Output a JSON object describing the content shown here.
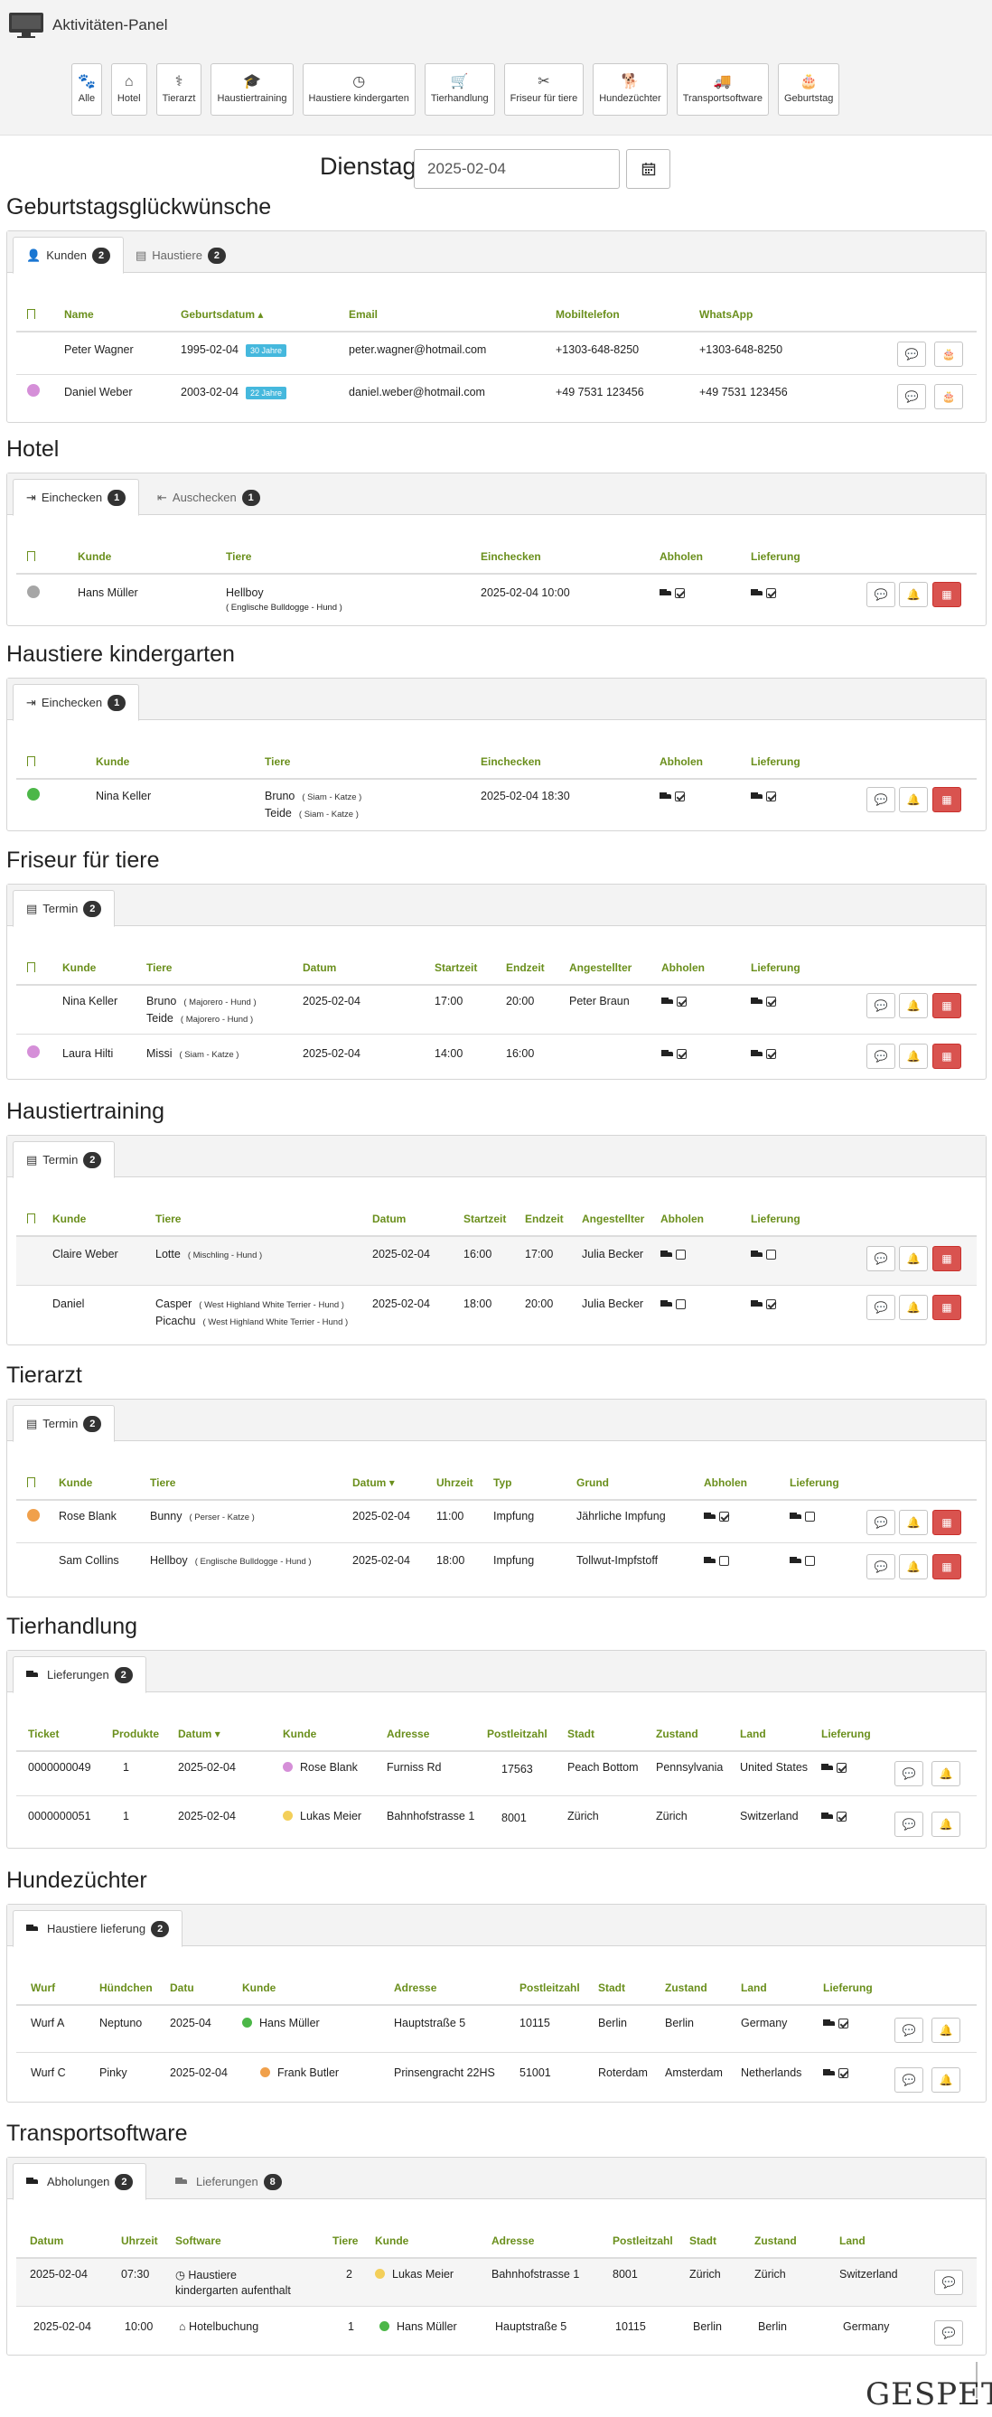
{
  "app": {
    "title": "Aktivitäten-Panel"
  },
  "categories": [
    {
      "label": "Alle",
      "icon": "paw-icon",
      "glyph": "🐾"
    },
    {
      "label": "Hotel",
      "icon": "home-icon",
      "glyph": "⌂"
    },
    {
      "label": "Tierarzt",
      "icon": "user-md-icon",
      "glyph": "⚕"
    },
    {
      "label": "Haustiertraining",
      "icon": "graduation-cap-icon",
      "glyph": "🎓"
    },
    {
      "label": "Haustiere kindergarten",
      "icon": "clock-icon",
      "glyph": "◷"
    },
    {
      "label": "Tierhandlung",
      "icon": "cart-icon",
      "glyph": "🛒"
    },
    {
      "label": "Friseur für tiere",
      "icon": "scissors-icon",
      "glyph": "✂"
    },
    {
      "label": "Hundezüchter",
      "icon": "dog-icon",
      "glyph": "🐕"
    },
    {
      "label": "Transportsoftware",
      "icon": "truck-icon",
      "glyph": "🚚"
    },
    {
      "label": "Geburtstag",
      "icon": "birthday-cake-icon",
      "glyph": "🎂"
    }
  ],
  "date": {
    "label": "Dienstag,",
    "value": "2025-02-04"
  },
  "birthday": {
    "title": "Geburtstagsglückwünsche",
    "tabs": [
      {
        "label": "Kunden",
        "count": "2"
      },
      {
        "label": "Haustiere",
        "count": "2"
      }
    ],
    "headers": [
      "Name",
      "Geburtsdatum",
      "Email",
      "Mobiltelefon",
      "WhatsApp"
    ],
    "rows": [
      {
        "name": "Peter Wagner",
        "birth": "1995-02-04",
        "age": "30 Jahre",
        "email": "peter.wagner@hotmail.com",
        "mobile": "+1303-648-8250",
        "whatsapp": "+1303-648-8250",
        "dot": ""
      },
      {
        "name": "Daniel Weber",
        "birth": "2003-02-04",
        "age": "22 Jahre",
        "email": "daniel.weber@hotmail.com",
        "mobile": "+49 7531 123456",
        "whatsapp": "+49 7531 123456",
        "dot": "#d58fd8"
      }
    ]
  },
  "hotel": {
    "title": "Hotel",
    "tabs": [
      {
        "label": "Einchecken",
        "count": "1"
      },
      {
        "label": "Auschecken",
        "count": "1"
      }
    ],
    "headers": [
      "Kunde",
      "Tiere",
      "Einchecken",
      "Abholen",
      "Lieferung"
    ],
    "rows": [
      {
        "customer": "Hans Müller",
        "pet": "Hellboy",
        "pet_sub": "( Englische Bulldogge - Hund )",
        "checkin": "2025-02-04 10:00",
        "dot": "#a6a6a6",
        "pickup": true,
        "delivery": true
      }
    ]
  },
  "kindergarten": {
    "title": "Haustiere kindergarten",
    "tabs": [
      {
        "label": "Einchecken",
        "count": "1"
      }
    ],
    "headers": [
      "Kunde",
      "Tiere",
      "Einchecken",
      "Abholen",
      "Lieferung"
    ],
    "rows": [
      {
        "customer": "Nina Keller",
        "pet1": "Bruno",
        "pet1_sub": "( Siam - Katze )",
        "pet2": "Teide",
        "pet2_sub": "( Siam - Katze )",
        "checkin": "2025-02-04 18:30",
        "dot": "#4cb748",
        "pickup": true,
        "delivery": true
      }
    ]
  },
  "groomer": {
    "title": "Friseur für tiere",
    "tabs": [
      {
        "label": "Termin",
        "count": "2"
      }
    ],
    "headers": [
      "Kunde",
      "Tiere",
      "Datum",
      "Startzeit",
      "Endzeit",
      "Angestellter",
      "Abholen",
      "Lieferung"
    ],
    "rows": [
      {
        "customer": "Nina Keller",
        "pet1": "Bruno",
        "pet1_sub": "( Majorero - Hund )",
        "pet2": "Teide",
        "pet2_sub": "( Majorero - Hund )",
        "date": "2025-02-04",
        "start": "17:00",
        "end": "20:00",
        "employee": "Peter Braun",
        "dot": "",
        "pickup": true,
        "delivery": true
      },
      {
        "customer": "Laura Hilti",
        "pet1": "Missi",
        "pet1_sub": "( Siam - Katze )",
        "date": "2025-02-04",
        "start": "14:00",
        "end": "16:00",
        "employee": "",
        "dot": "#d58fd8",
        "pickup": true,
        "delivery": true
      }
    ]
  },
  "training": {
    "title": "Haustiertraining",
    "tabs": [
      {
        "label": "Termin",
        "count": "2"
      }
    ],
    "headers": [
      "Kunde",
      "Tiere",
      "Datum",
      "Startzeit",
      "Endzeit",
      "Angestellter",
      "Abholen",
      "Lieferung"
    ],
    "rows": [
      {
        "customer": "Claire  Weber",
        "pet1": "Lotte",
        "pet1_sub": "( Mischling - Hund )",
        "date": "2025-02-04",
        "start": "16:00",
        "end": "17:00",
        "employee": "Julia Becker",
        "pickup": false,
        "delivery": false
      },
      {
        "customer": "Daniel",
        "pet1": "Casper",
        "pet1_sub": "( West Highland White Terrier - Hund )",
        "pet2": "Picachu",
        "pet2_sub": "( West Highland White Terrier - Hund )",
        "date": "2025-02-04",
        "start": "18:00",
        "end": "20:00",
        "employee": "Julia Becker",
        "pickup": false,
        "delivery": true
      }
    ]
  },
  "vet": {
    "title": "Tierarzt",
    "tabs": [
      {
        "label": "Termin",
        "count": "2"
      }
    ],
    "headers": [
      "Kunde",
      "Tiere",
      "Datum",
      "Uhrzeit",
      "Typ",
      "Grund",
      "Abholen",
      "Lieferung"
    ],
    "rows": [
      {
        "customer": "Rose Blank",
        "pet": "Bunny",
        "pet_sub": "( Perser - Katze )",
        "date": "2025-02-04",
        "time": "11:00",
        "type": "Impfung",
        "reason": "Jährliche Impfung",
        "dot": "#f0a04b",
        "pickup": true,
        "delivery": false
      },
      {
        "customer": "Sam Collins",
        "pet": "Hellboy",
        "pet_sub": "( Englische  Bulldogge -  Hund )",
        "date": "2025-02-04",
        "time": "18:00",
        "type": "Impfung",
        "reason": "Tollwut-Impfstoff",
        "dot": "",
        "pickup": false,
        "delivery": false
      }
    ]
  },
  "shop": {
    "title": "Tierhandlung",
    "tabs": [
      {
        "label": "Lieferungen",
        "count": "2"
      }
    ],
    "headers": [
      "Ticket",
      "Produkte",
      "Datum",
      "Kunde",
      "Adresse",
      "Postleitzahl",
      "Stadt",
      "Zustand",
      "Land",
      "Lieferung"
    ],
    "rows": [
      {
        "ticket": "0000000049",
        "products": "1",
        "date": "2025-02-04",
        "customer": "Rose  Blank",
        "dot": "#d58fd8",
        "address": "Furniss Rd",
        "zip": "17563",
        "city": "Peach Bottom",
        "state": "Pennsylvania",
        "country": "United States"
      },
      {
        "ticket": "0000000051",
        "products": "1",
        "date": "2025-02-04",
        "customer": "Lukas Meier",
        "dot": "#f3cf5a",
        "address": "Bahnhofstrasse 1",
        "zip": "8001",
        "city": "Zürich",
        "state": "Zürich",
        "country": "Switzerland"
      }
    ]
  },
  "breeder": {
    "title": "Hundezüchter",
    "tabs": [
      {
        "label": "Haustiere lieferung",
        "count": "2"
      }
    ],
    "headers": [
      "Wurf",
      "Hündchen",
      "Datu",
      "Kunde",
      "Adresse",
      "Postleitzahl",
      "Stadt",
      "Zustand",
      "Land",
      "Lieferung"
    ],
    "rows": [
      {
        "litter": "Wurf A",
        "puppy": "Neptuno",
        "date": "2025-04",
        "customer": "Hans Müller",
        "dot": "#4cb748",
        "address": "Hauptstraße 5",
        "zip": "10115",
        "city": "Berlin",
        "state": "Berlin",
        "country": "Germany"
      },
      {
        "litter": "Wurf C",
        "puppy": "Pinky",
        "date": "2025-02-04",
        "customer": "Frank  Butler",
        "dot": "#f0a04b",
        "address": "Prinsengracht 22HS",
        "zip": "51001",
        "city": "Roterdam",
        "state": "Amsterdam",
        "country": "Netherlands"
      }
    ]
  },
  "transport": {
    "title": "Transportsoftware",
    "tabs": [
      {
        "label": "Abholungen",
        "count": "2"
      },
      {
        "label": "Lieferungen",
        "count": "8"
      }
    ],
    "headers": [
      "Datum",
      "Uhrzeit",
      "Software",
      "Tiere",
      "Kunde",
      "Adresse",
      "Postleitzahl",
      "Stadt",
      "Zustand",
      "Land"
    ],
    "rows": [
      {
        "date": "2025-02-04",
        "time": "07:30",
        "software": "Haustiere",
        "software2": "kindergarten aufenthalt",
        "pets": "2",
        "customer": "Lukas Meier",
        "dot": "#f3cf5a",
        "address": "Bahnhofstrasse 1",
        "zip": "8001",
        "city": "Zürich",
        "state": "Zürich",
        "country": "Switzerland"
      },
      {
        "date": "2025-02-04",
        "time": "10:00",
        "software": "Hotelbuchung",
        "pets": "1",
        "customer": "Hans  Müller",
        "dot": "#4cb748",
        "address": "Hauptstraße 5",
        "zip": "10115",
        "city": "Berlin",
        "state": "Berlin",
        "country": "Germany"
      }
    ]
  },
  "brand": {
    "name": "GESPET"
  }
}
